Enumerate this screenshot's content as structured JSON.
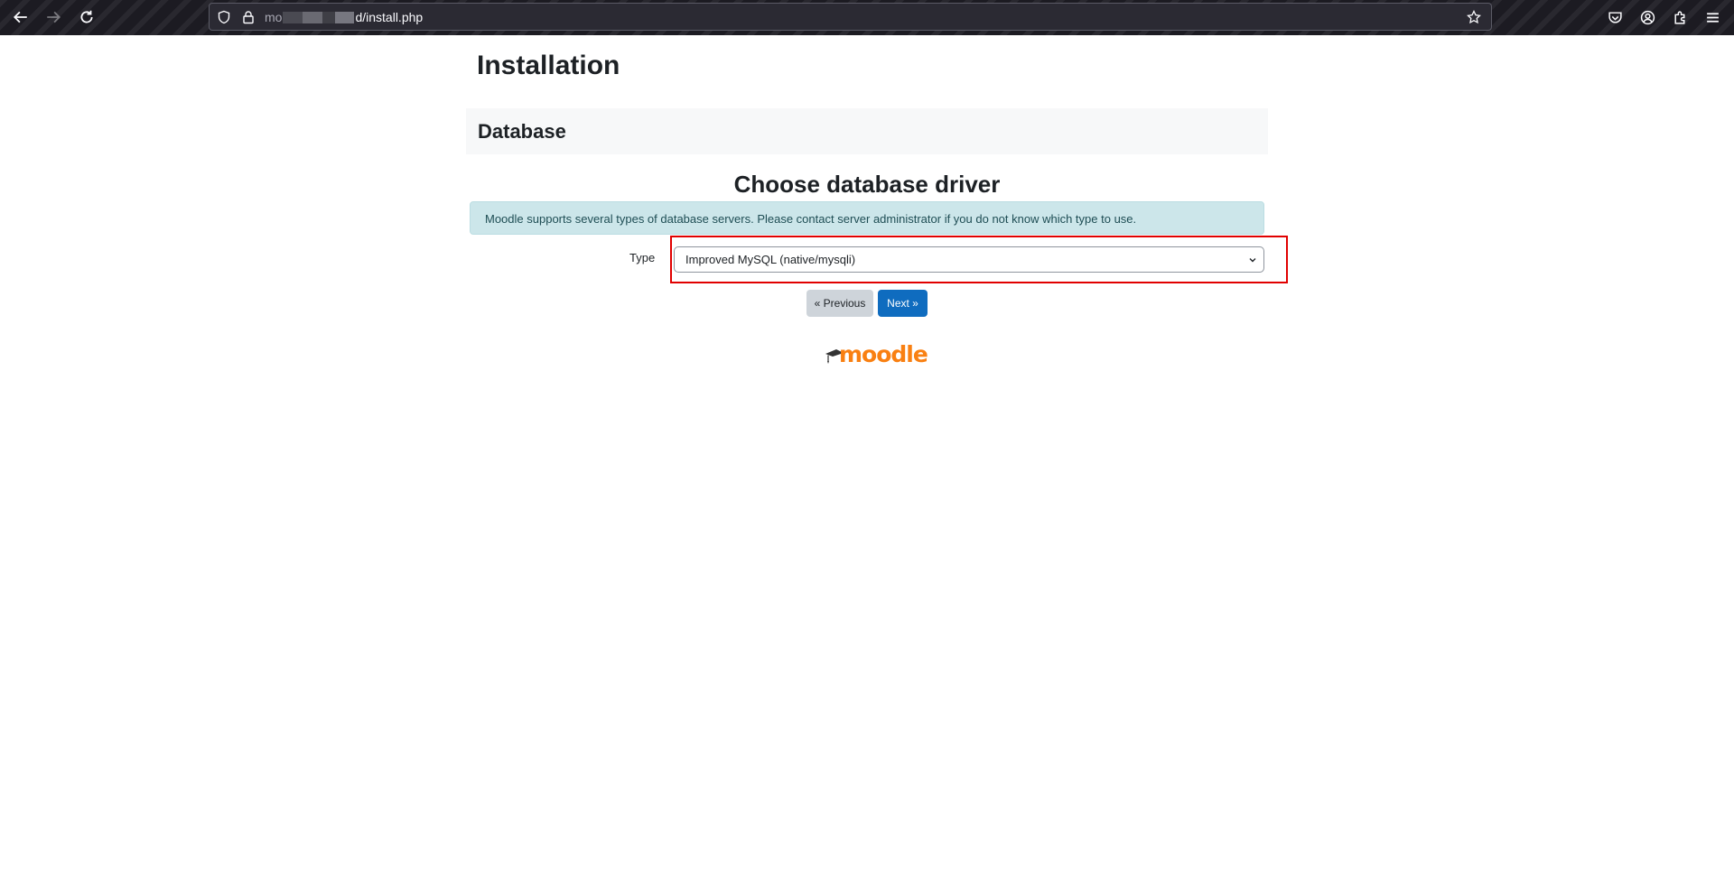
{
  "browser": {
    "url_host_start": "mo",
    "url_host_end": "d",
    "url_path": "/install.php"
  },
  "page": {
    "title": "Installation",
    "section_title": "Database",
    "stage_title": "Choose database driver",
    "info_message": "Moodle supports several types of database servers. Please contact server administrator if you do not know which type to use.",
    "type_label": "Type",
    "type_select_value": "Improved MySQL (native/mysqli)",
    "previous_label": "« Previous",
    "next_label": "Next »",
    "logo_text": "moodle"
  },
  "colors": {
    "primary": "#0f6cbf",
    "secondary": "#ced4da",
    "alert_info_bg": "#cce6ea",
    "highlight": "#e10000",
    "moodle_orange": "#f98012"
  }
}
